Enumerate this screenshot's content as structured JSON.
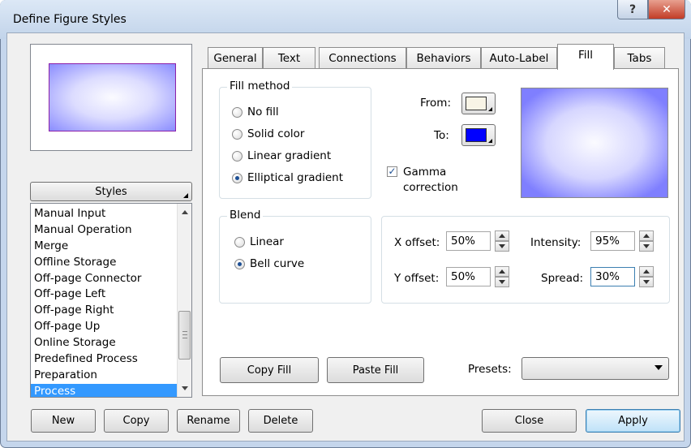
{
  "window": {
    "title": "Define Figure Styles",
    "help_glyph": "?",
    "close_glyph": "✕"
  },
  "left": {
    "styles_button": "Styles",
    "style_list": [
      "Manual Input",
      "Manual Operation",
      "Merge",
      "Offline Storage",
      "Off-page Connector",
      "Off-page Left",
      "Off-page Right",
      "Off-page Up",
      "Online Storage",
      "Predefined Process",
      "Preparation",
      "Process"
    ],
    "selected_style": "Process"
  },
  "tabs": [
    "General",
    "Text",
    "Connections",
    "Behaviors",
    "Auto-Label",
    "Fill",
    "Tabs"
  ],
  "active_tab": "Fill",
  "fill": {
    "method_label": "Fill method",
    "methods": [
      "No fill",
      "Solid color",
      "Linear gradient",
      "Elliptical gradient"
    ],
    "selected_method": "Elliptical gradient",
    "from_label": "From:",
    "to_label": "To:",
    "from_color": "#f8f4e6",
    "to_color": "#0000ff",
    "gamma_line1": "Gamma",
    "gamma_line2": "correction",
    "gamma_checked": true,
    "blend_label": "Blend",
    "blends": [
      "Linear",
      "Bell curve"
    ],
    "selected_blend": "Bell curve",
    "x_offset_label": "X offset:",
    "x_offset": "50%",
    "y_offset_label": "Y offset:",
    "y_offset": "50%",
    "intensity_label": "Intensity:",
    "intensity": "95%",
    "spread_label": "Spread:",
    "spread": "30%",
    "copy_fill": "Copy Fill",
    "paste_fill": "Paste Fill",
    "presets_label": "Presets:",
    "presets_value": ""
  },
  "bottom": {
    "new": "New",
    "copy": "Copy",
    "rename": "Rename",
    "delete": "Delete",
    "close": "Close",
    "apply": "Apply"
  },
  "colors": {
    "selection": "#3399ff",
    "gradient_center": "#fbfbff",
    "gradient_edge": "#7f7fff",
    "shape_border": "#8c1fa8"
  }
}
